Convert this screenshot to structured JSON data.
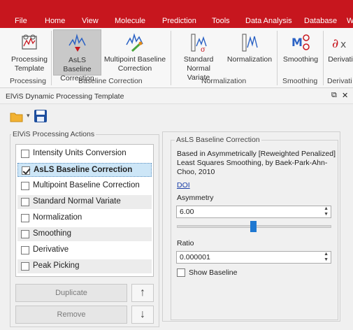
{
  "menu": [
    "File",
    "Home",
    "View",
    "Molecule",
    "Prediction",
    "Tools",
    "Data Analysis",
    "Database",
    "W"
  ],
  "ribbon": {
    "buttons": [
      {
        "label1": "Processing",
        "label2": "Template",
        "icon": "processing-template-icon"
      },
      {
        "label1": "AsLS Baseline",
        "label2": "Correction",
        "icon": "asls-baseline-icon",
        "active": true
      },
      {
        "label1": "Multipoint Baseline",
        "label2": "Correction",
        "icon": "multipoint-baseline-icon"
      },
      {
        "label1": "Standard",
        "label2": "Normal Variate",
        "icon": "standard-normal-variate-icon"
      },
      {
        "label1": "Normalization",
        "label2": "",
        "icon": "normalization-icon"
      },
      {
        "label1": "Smoothing",
        "label2": "",
        "icon": "smoothing-icon"
      },
      {
        "label1": "Derivati",
        "label2": "",
        "icon": "derivative-icon"
      }
    ],
    "groups": [
      "Processing",
      "Baseline Correction",
      "Normalization",
      "Smoothing",
      "Derivati"
    ]
  },
  "panel": {
    "title": "ElViS Dynamic Processing Template",
    "pin": "⧉",
    "close": "✕"
  },
  "toolbar": {
    "open_icon": "folder-open-icon",
    "save_icon": "save-disk-icon"
  },
  "actions": {
    "legend": "ElViS Processing Actions",
    "items": [
      {
        "label": "Intensity Units Conversion",
        "checked": false
      },
      {
        "label": "AsLS Baseline Correction",
        "checked": true
      },
      {
        "label": "Multipoint Baseline Correction",
        "checked": false
      },
      {
        "label": "Standard Normal Variate",
        "checked": false
      },
      {
        "label": "Normalization",
        "checked": false
      },
      {
        "label": "Smoothing",
        "checked": false
      },
      {
        "label": "Derivative",
        "checked": false
      },
      {
        "label": "Peak Picking",
        "checked": false
      }
    ],
    "duplicate": "Duplicate",
    "remove": "Remove",
    "up": "↑",
    "down": "↓"
  },
  "details": {
    "legend": "AsLS Baseline Correction",
    "description": "Based in Asymmetrically [Reweighted Penalized] Least Squares Smoothing, by Baek-Park-Ahn-Choo, 2010",
    "doi": "DOI",
    "asymmetry_label": "Asymmetry",
    "asymmetry_value": "6.00",
    "slider_fraction": 0.5,
    "ratio_label": "Ratio",
    "ratio_value": "0.000001",
    "show_baseline": "Show Baseline"
  },
  "colors": {
    "menubar": "#c7161e",
    "accent": "#1f78d1"
  }
}
